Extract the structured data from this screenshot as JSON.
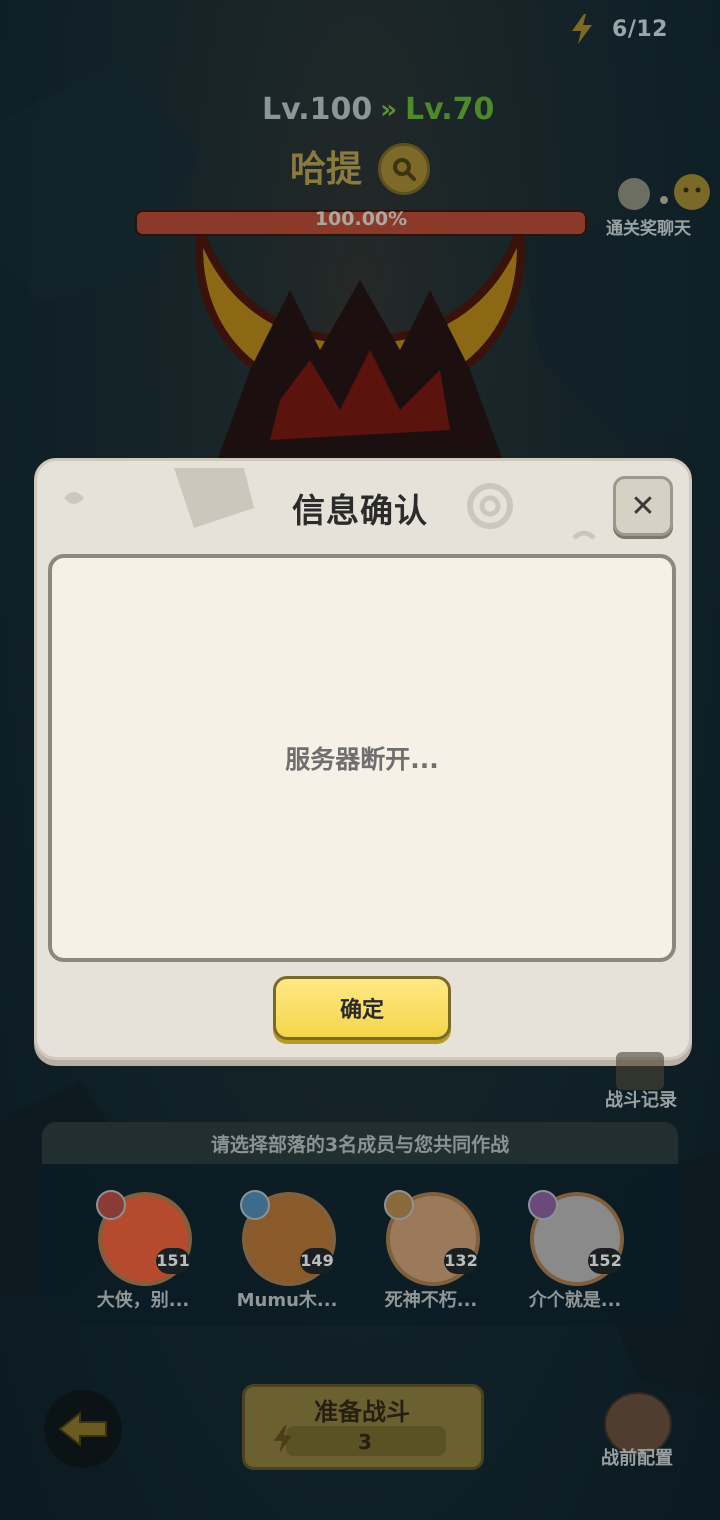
{
  "topbar": {
    "energy": "6/12",
    "energy_icon": "lightning-icon"
  },
  "boss": {
    "level_current": "Lv.100",
    "level_arrow": "»",
    "level_next": "Lv.70",
    "name": "哈提",
    "hp_percent_text": "100.00%",
    "hp_fraction": 1.0,
    "hp_color": "#8b3a2a"
  },
  "chat": {
    "label": "通关奖聊天"
  },
  "modal": {
    "title": "信息确认",
    "close": "✕",
    "message": "服务器断开...",
    "ok_label": "确定",
    "ok_color": "#f4d54a"
  },
  "battle_record": {
    "label": "战斗记录"
  },
  "tribe": {
    "title": "请选择部落的3名成员与您共同作战",
    "members": [
      {
        "name": "大侠，别...",
        "level": "151"
      },
      {
        "name": "Mumu木...",
        "level": "149"
      },
      {
        "name": "死神不朽...",
        "level": "132"
      },
      {
        "name": "介个就是...",
        "level": "152"
      }
    ]
  },
  "bottom": {
    "ready_label": "准备战斗",
    "ready_cost": "3",
    "prebattle_label": "战前配置"
  }
}
